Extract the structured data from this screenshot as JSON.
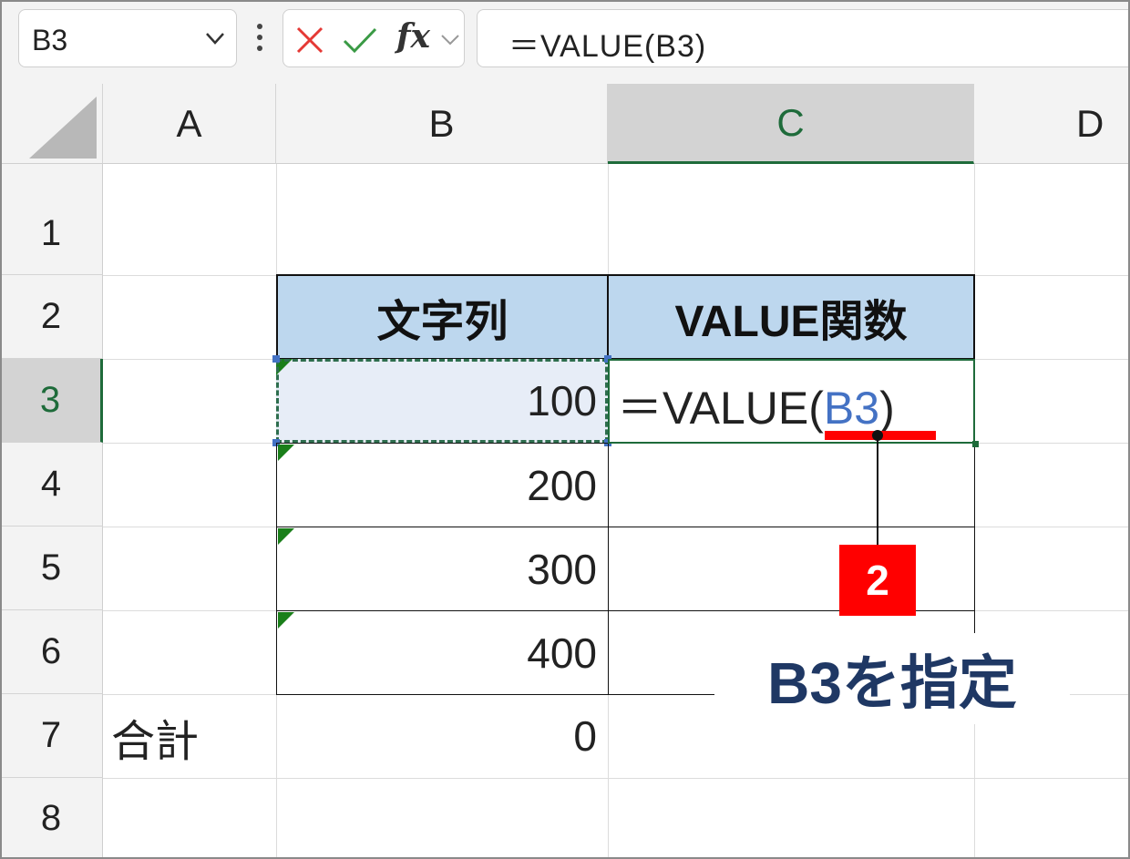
{
  "formula_bar": {
    "name_box": "B3",
    "formula": "＝VALUE(B3)",
    "cancel_icon": "x-icon",
    "enter_icon": "check-icon",
    "fx_label": "fx"
  },
  "columns": [
    "A",
    "B",
    "C",
    "D"
  ],
  "rows": [
    "1",
    "2",
    "3",
    "4",
    "5",
    "6",
    "7",
    "8"
  ],
  "selected": {
    "column": "C",
    "row": "3"
  },
  "table": {
    "headers": [
      "文字列",
      "VALUE関数"
    ],
    "values": [
      "100",
      "200",
      "300",
      "400"
    ],
    "formula_cell": {
      "prefix": "＝VALUE(",
      "ref": "B3",
      "suffix": ")"
    }
  },
  "total": {
    "label": "合計",
    "value": "0"
  },
  "callout": {
    "step": "2",
    "label": "B3を指定"
  },
  "colors": {
    "header_fill": "#bdd7ee",
    "selection_green": "#1e6b3a",
    "ref_blue": "#4472c4",
    "callout_red": "#ff0000",
    "callout_text": "#1f3864"
  }
}
